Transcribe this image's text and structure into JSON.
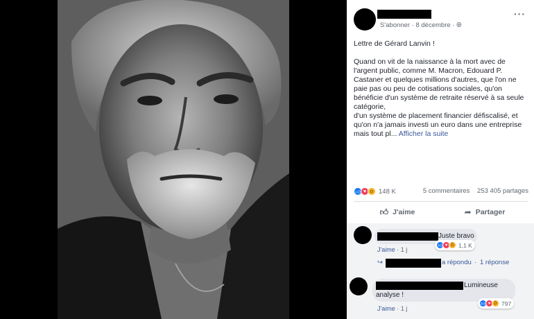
{
  "post": {
    "subscribe_label": "S'abonner",
    "date": "8 décembre",
    "globe_icon": "globe-icon",
    "more_icon": "more-options-icon",
    "title": "Lettre de Gérard Lanvin !",
    "body": "Quand on vit de la naissance à la mort avec de l'argent public, comme M. Macron, Edouard P. Castaner et quelques millions d'autres, que l'on ne paie pas ou peu de cotisations sociales, qu'on bénéficie d'un système de retraite réservé à sa seule catégorie,\nd'un système de placement financier défiscalisé, et qu'on n'a jamais investi un euro dans une entreprise mais tout pl...",
    "see_more": "Afficher la suite"
  },
  "stats": {
    "reactions": "148 K",
    "comments": "5 commentaires",
    "shares": "253 405 partages"
  },
  "actions": {
    "like": "J'aime",
    "share": "Partager"
  },
  "comments": [
    {
      "text": "Juste bravo",
      "like_label": "J'aime",
      "time": "1 j",
      "reaction_count": "1,1 K"
    },
    {
      "text": "Lumineuse",
      "text2": "analyse !",
      "like_label": "J'aime",
      "time": "1 j",
      "reaction_count": "797"
    }
  ],
  "reply": {
    "replied": "a répondu",
    "count": "1 réponse"
  },
  "colors": {
    "link": "#385898",
    "meta": "#606770",
    "like_blue": "#1877f2",
    "love_red": "#f33e58",
    "wow_yellow": "#f7b125"
  }
}
